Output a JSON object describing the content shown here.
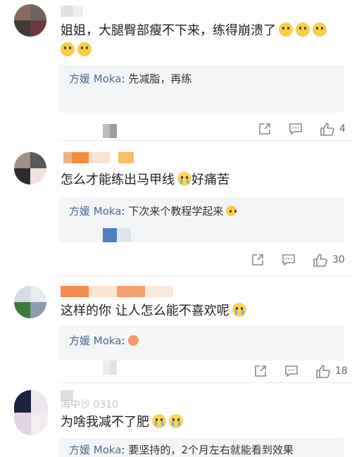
{
  "comments": [
    {
      "text": "姐姐，大腿臀部瘦不下来，练得崩溃了",
      "text_line2": "",
      "reply_author": "方媛 Moka",
      "reply_text": ": 先减脂，再练",
      "like_count": "4"
    },
    {
      "text": "怎么才能练出马甲线",
      "text_after": "好痛苦",
      "reply_author": "方媛 Moka",
      "reply_text": ": 下次来个教程学起来",
      "like_count": "30"
    },
    {
      "text": "这样的你 让人怎么能不喜欢呢",
      "reply_author": "方媛 Moka",
      "reply_text": ":",
      "like_count": "18"
    },
    {
      "text": "为啥我减不了肥",
      "username_partial": "海中沙 0310",
      "reply_author": "方媛 Moka",
      "reply_text": ": 要坚持的，2个月左右就能看到效果"
    }
  ],
  "icons": {
    "share": "share-icon",
    "comment": "comment-icon",
    "like": "thumbs-up-icon"
  },
  "colors": {
    "reply_author": "#4f6b95",
    "reply_bg": "#f4f5f7",
    "text": "#222222"
  }
}
